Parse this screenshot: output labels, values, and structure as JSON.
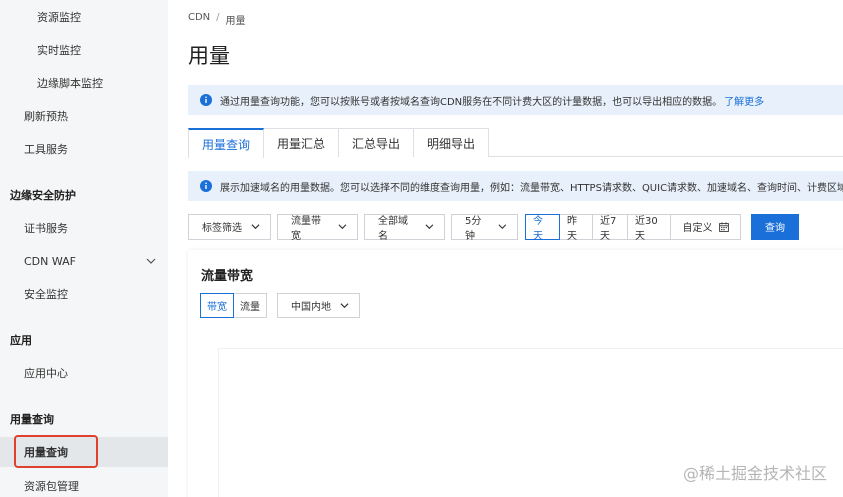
{
  "sidebar": {
    "items": [
      {
        "label": "资源监控",
        "level": "sub",
        "top": 0
      },
      {
        "label": "实时监控",
        "level": "sub"
      },
      {
        "label": "边缘脚本监控",
        "level": "sub"
      },
      {
        "label": "刷新预热",
        "level": "lvl1"
      },
      {
        "label": "工具服务",
        "level": "lvl1"
      }
    ],
    "group_edge_security": "边缘安全防护",
    "cert_service": "证书服务",
    "cdn_waf": "CDN WAF",
    "security_monitor": "安全监控",
    "group_app": "应用",
    "app_center": "应用中心",
    "group_usage": "用量查询",
    "usage_query": "用量查询",
    "package_manage": "资源包管理"
  },
  "breadcrumb": {
    "root": "CDN",
    "separator": "/",
    "current": "用量"
  },
  "page_title": "用量",
  "notice_top": {
    "text": "通过用量查询功能，您可以按账号或者按域名查询CDN服务在不同计费大区的计量数据，也可以导出相应的数据。",
    "link": "了解更多"
  },
  "tabs": [
    "用量查询",
    "用量汇总",
    "汇总导出",
    "明细导出"
  ],
  "notice_tab": {
    "text": "展示加速域名的用量数据。您可以选择不同的维度查询用量，例如：流量带宽、HTTPS请求数、QUIC请求数、加速域名、查询时间、计费区域等"
  },
  "filters": {
    "tag_filter": "标签筛选",
    "metric": "流量带宽",
    "domain": "全部域名",
    "interval": "5分钟",
    "ranges": [
      "今天",
      "昨天",
      "近7天",
      "近30天"
    ],
    "custom": "自定义",
    "query_button": "查询"
  },
  "card": {
    "title": "流量带宽",
    "metric_tabs": [
      "带宽",
      "流量"
    ],
    "region": "中国内地"
  },
  "watermark": "@稀土掘金技术社区",
  "colors": {
    "primary": "#1a6fd8",
    "notice_bg": "#e8f1fb",
    "highlight": "#e0412f",
    "sidebar_bg": "#f5f6f7"
  }
}
